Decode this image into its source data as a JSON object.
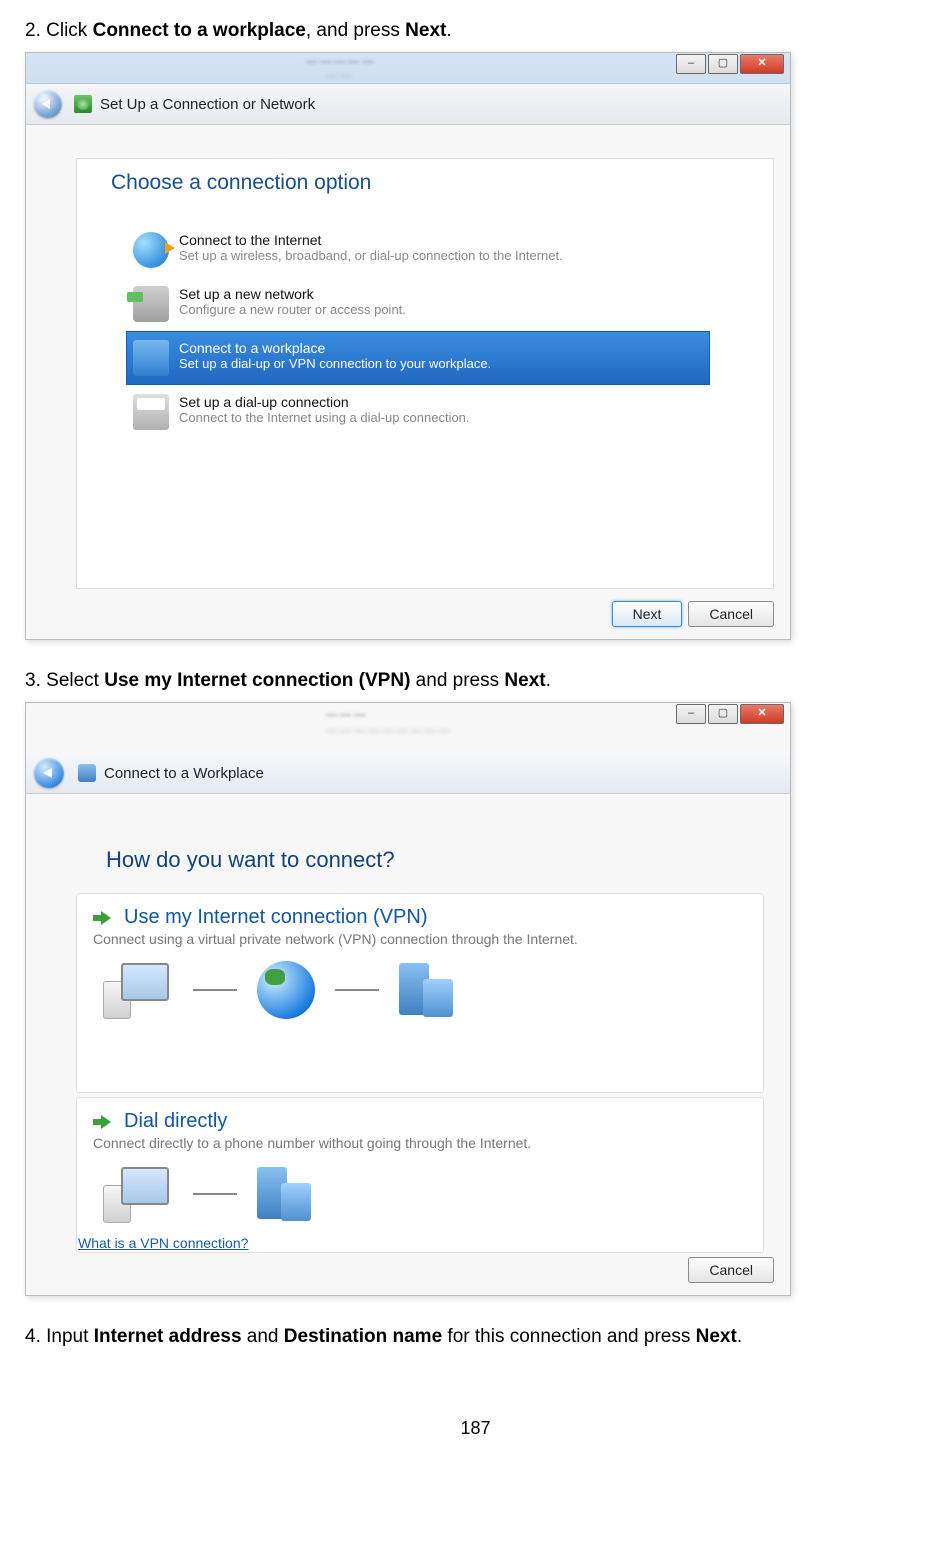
{
  "steps": {
    "s2": {
      "num": "2.",
      "t1": "Click ",
      "b1": "Connect to a workplace",
      "t2": ", and press ",
      "b2": "Next",
      "t3": "."
    },
    "s3": {
      "num": "3.",
      "t1": "Select ",
      "b1": "Use my Internet connection (VPN)",
      "t2": " and press ",
      "b2": "Next",
      "t3": "."
    },
    "s4": {
      "num": "4.",
      "t1": "Input ",
      "b1": "Internet address",
      "t2": " and ",
      "b2": "Destination name",
      "t3": " for this connection and press ",
      "b3": "Next",
      "t4": "."
    }
  },
  "ss1": {
    "title": "Set Up a Connection or Network",
    "heading": "Choose a connection option",
    "opts": [
      {
        "t": "Connect to the Internet",
        "s": "Set up a wireless, broadband, or dial-up connection to the Internet."
      },
      {
        "t": "Set up a new network",
        "s": "Configure a new router or access point."
      },
      {
        "t": "Connect to a workplace",
        "s": "Set up a dial-up or VPN connection to your workplace."
      },
      {
        "t": "Set up a dial-up connection",
        "s": "Connect to the Internet using a dial-up connection."
      }
    ],
    "next": "Next",
    "cancel": "Cancel"
  },
  "ss2": {
    "title": "Connect to a Workplace",
    "heading": "How do you want to connect?",
    "c1": {
      "t": "Use my Internet connection (VPN)",
      "s": "Connect using a virtual private network (VPN) connection through the Internet."
    },
    "c2": {
      "t": "Dial directly",
      "s": "Connect directly to a phone number without going through the Internet."
    },
    "link": "What is a VPN connection?",
    "cancel": "Cancel"
  },
  "pagenum": "187"
}
